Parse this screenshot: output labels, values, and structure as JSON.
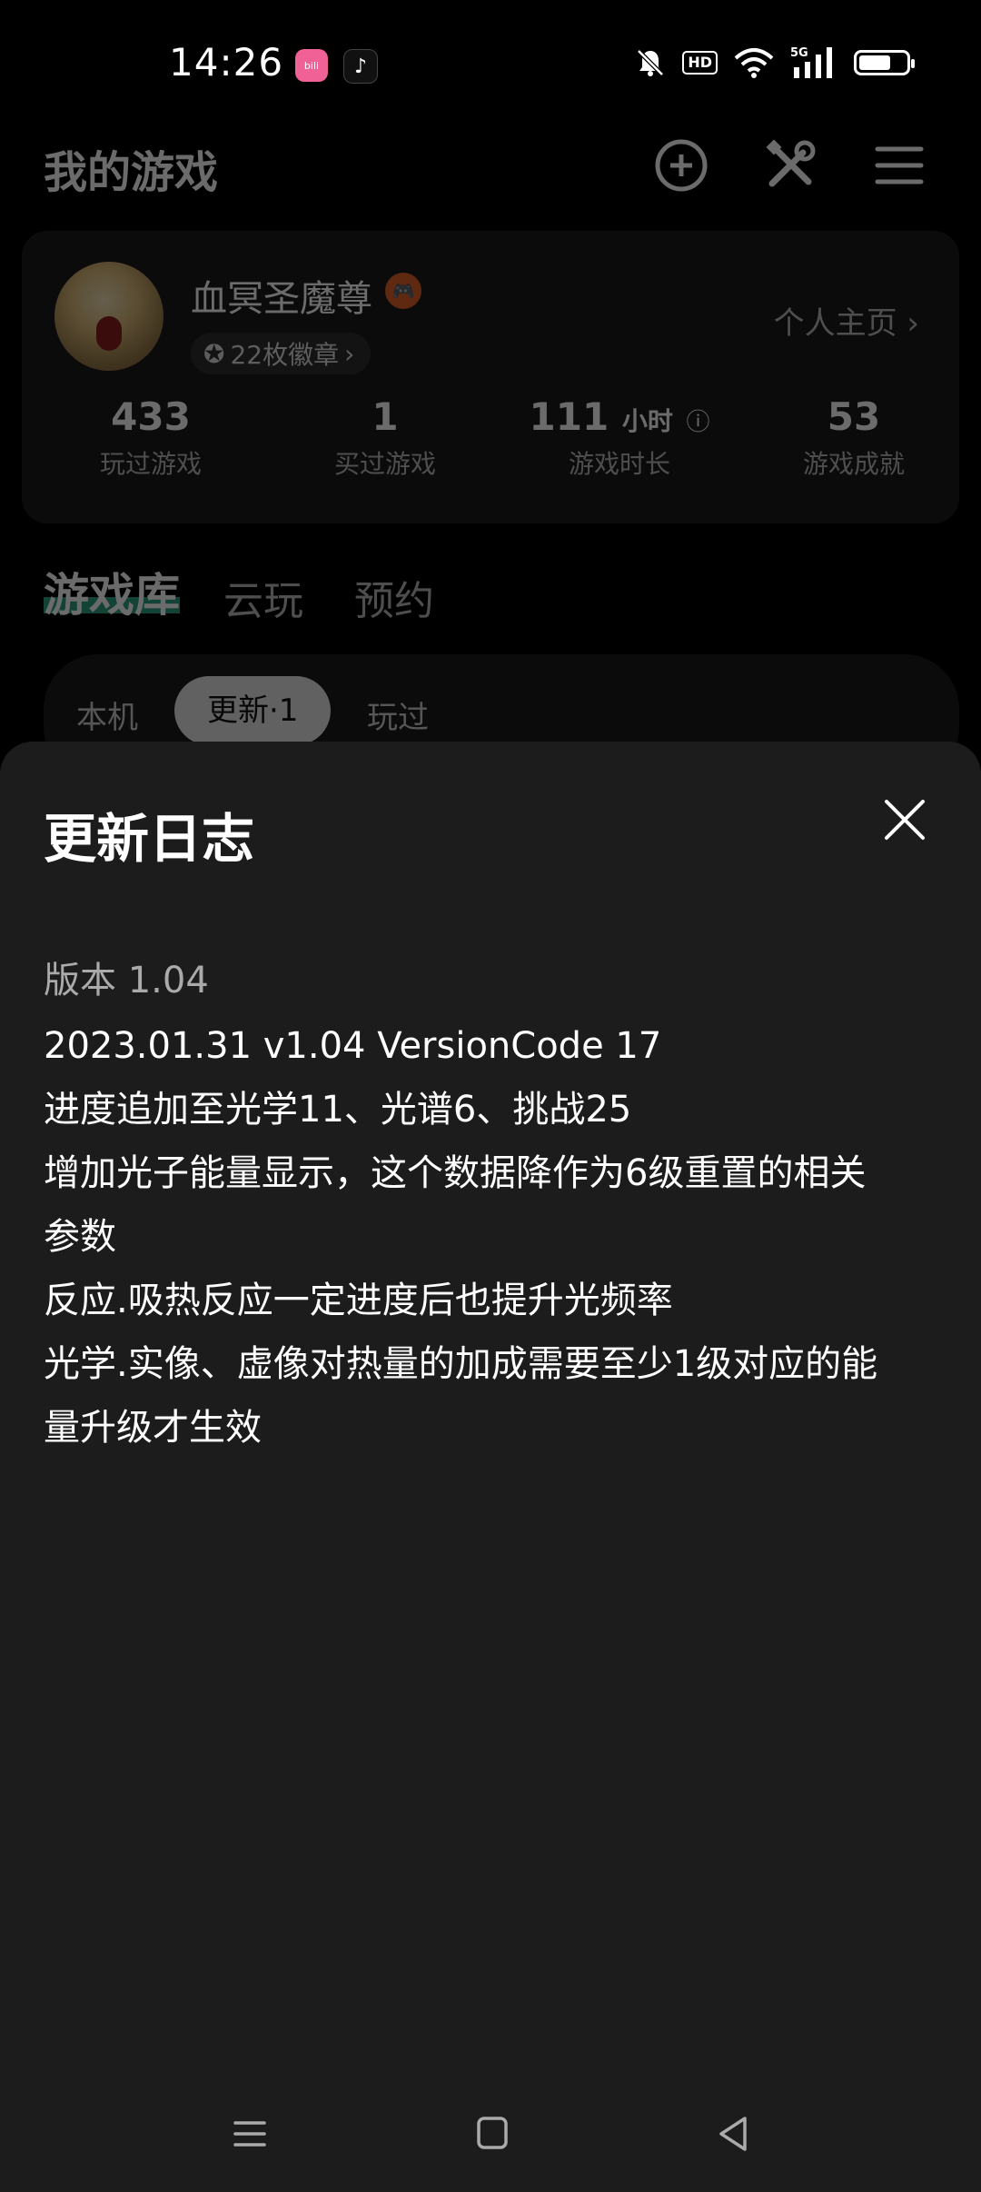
{
  "status_bar": {
    "time": "14:26",
    "app_icons": [
      "bilibili-icon",
      "tiktok-icon"
    ],
    "indicators": [
      "bell-muted-icon",
      "hd-badge",
      "wifi-icon",
      "5g-signal-icon",
      "battery-icon"
    ],
    "hd_label": "HD",
    "network_label": "5G"
  },
  "header": {
    "title": "我的游戏",
    "icons": [
      "add-circle-icon",
      "tools-icon",
      "menu-icon"
    ]
  },
  "profile": {
    "username": "血冥圣魔尊",
    "badge_count_label": "22枚徽章",
    "profile_link": "个人主页",
    "stats": [
      {
        "value": "433",
        "unit": "",
        "label": "玩过游戏"
      },
      {
        "value": "1",
        "unit": "",
        "label": "买过游戏"
      },
      {
        "value": "111",
        "unit": "小时",
        "label": "游戏时长"
      },
      {
        "value": "53",
        "unit": "",
        "label": "游戏成就"
      }
    ]
  },
  "library_tabs": [
    {
      "label": "游戏库",
      "active": true
    },
    {
      "label": "云玩",
      "active": false
    },
    {
      "label": "预约",
      "active": false
    }
  ],
  "sub_tabs": [
    {
      "label": "本机",
      "active": false
    },
    {
      "label": "更新·1",
      "active": true
    },
    {
      "label": "玩过",
      "active": false
    }
  ],
  "sheet": {
    "title": "更新日志",
    "version_label": "版本 1.04",
    "log_lines": [
      "2023.01.31 v1.04 VersionCode 17",
      "进度追加至光学11、光谱6、挑战25",
      "增加光子能量显示，这个数据降作为6级重置的相关",
      "参数",
      "反应.吸热反应一定进度后也提升光频率",
      "光学.实像、虚像对热量的加成需要至少1级对应的能",
      "量升级才生效"
    ]
  },
  "nav_bar": {
    "buttons": [
      "nav-menu-icon",
      "nav-home-icon",
      "nav-back-icon"
    ]
  }
}
